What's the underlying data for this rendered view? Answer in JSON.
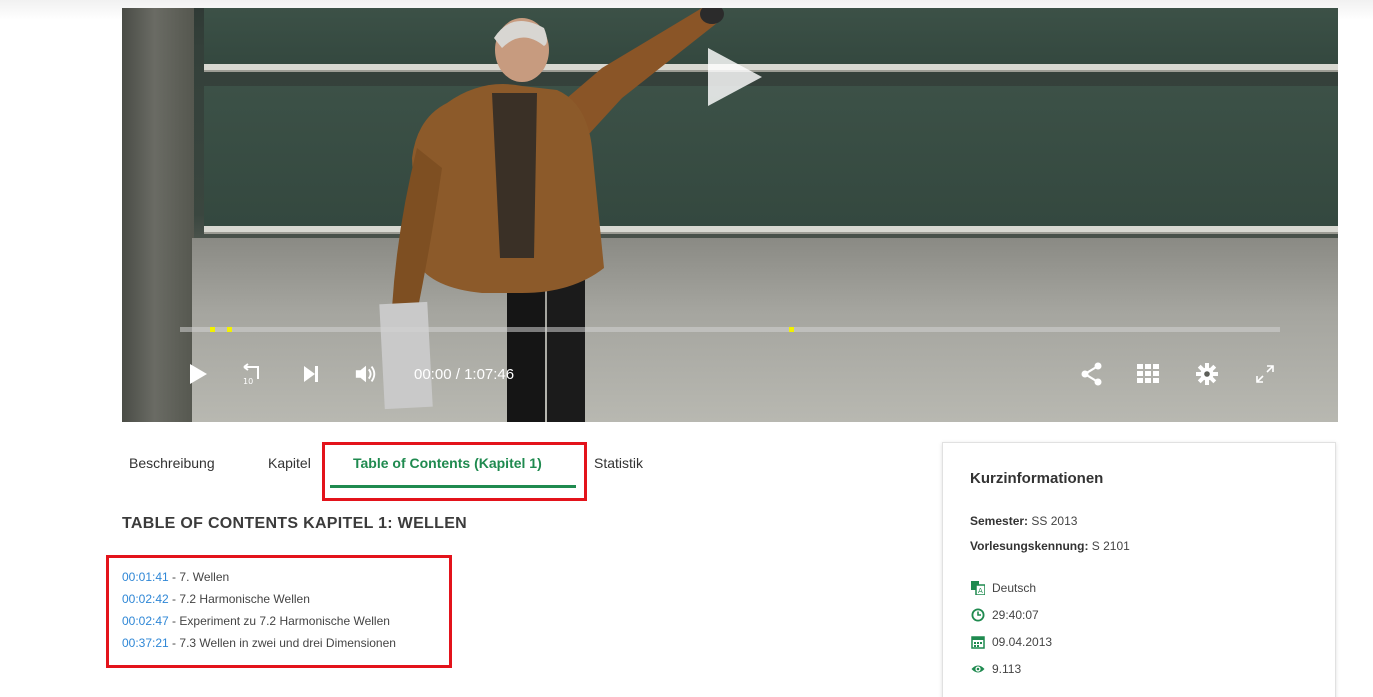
{
  "player": {
    "time_current": "00:00",
    "time_separator": "/",
    "time_total": "1:07:46",
    "progress_fraction": 0.0,
    "chapter_marker_positions_fraction": [
      0.027,
      0.043,
      0.554
    ],
    "icons": {
      "play": "play-icon",
      "rewind": "rewind-10-icon",
      "skip": "skip-next-icon",
      "volume": "volume-icon",
      "share": "share-icon",
      "grid": "grid-icon",
      "settings": "gear-icon",
      "fullscreen": "fullscreen-icon"
    },
    "marker_color": "#f2f200"
  },
  "tabs": [
    {
      "label": "Beschreibung",
      "active": false
    },
    {
      "label": "Kapitel",
      "active": false
    },
    {
      "label": "Table of Contents (Kapitel 1)",
      "active": true
    },
    {
      "label": "Statistik",
      "active": false
    }
  ],
  "toc": {
    "heading": "TABLE OF CONTENTS KAPITEL 1: WELLEN",
    "separator": " - ",
    "entries": [
      {
        "time": "00:01:41",
        "title": "7. Wellen"
      },
      {
        "time": "00:02:42",
        "title": "7.2 Harmonische Wellen"
      },
      {
        "time": "00:02:47",
        "title": "Experiment zu 7.2 Harmonische Wellen"
      },
      {
        "time": "00:37:21",
        "title": "7.3 Wellen in zwei und drei Dimensionen"
      }
    ]
  },
  "info": {
    "title": "Kurzinformationen",
    "semester_label": "Semester:",
    "semester_value": "SS 2013",
    "course_id_label": "Vorlesungskennung:",
    "course_id_value": "S 2101",
    "language": "Deutsch",
    "duration": "29:40:07",
    "date": "09.04.2013",
    "views": "9.113",
    "icons": [
      "language-icon",
      "clock-icon",
      "calendar-icon",
      "eye-icon"
    ]
  },
  "colors": {
    "accent_green": "#1f8a4f",
    "link_blue": "#2f87d6",
    "highlight_red": "#e3131b"
  }
}
